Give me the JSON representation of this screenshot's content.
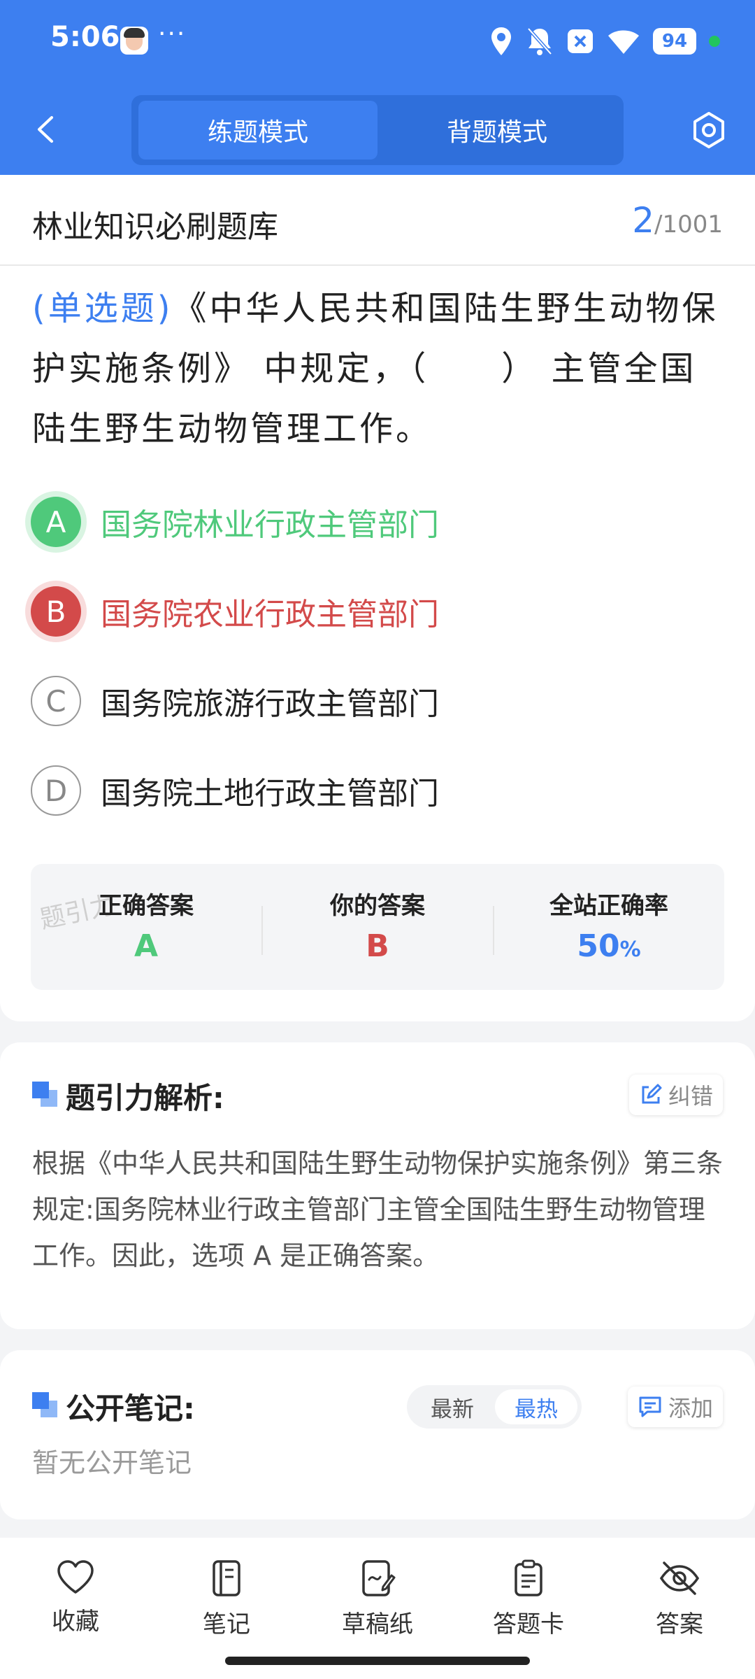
{
  "status_bar": {
    "time": "5:06",
    "dots": "···",
    "battery": "94"
  },
  "nav": {
    "tabs": [
      {
        "label": "练题模式",
        "active": true
      },
      {
        "label": "背题模式",
        "active": false
      }
    ]
  },
  "question_bank": {
    "title": "林业知识必刷题库",
    "current": "2",
    "total": "/1001"
  },
  "question": {
    "type": "(单选题)",
    "text": "《中华人民共和国陆生野生动物保护实施条例》 中规定，（　　） 主管全国陆生野生动物管理工作。",
    "options": [
      {
        "letter": "A",
        "text": "国务院林业行政主管部门",
        "state": "correct"
      },
      {
        "letter": "B",
        "text": "国务院农业行政主管部门",
        "state": "wrong"
      },
      {
        "letter": "C",
        "text": "国务院旅游行政主管部门",
        "state": "normal"
      },
      {
        "letter": "D",
        "text": "国务院土地行政主管部门",
        "state": "normal"
      }
    ]
  },
  "answer_summary": {
    "correct_label": "正确答案",
    "correct_value": "A",
    "yours_label": "你的答案",
    "yours_value": "B",
    "rate_label": "全站正确率",
    "rate_value": "50",
    "rate_unit": "%",
    "watermark": "题引力"
  },
  "analysis": {
    "title": "题引力解析:",
    "report_label": "纠错",
    "text": "根据《中华人民共和国陆生野生动物保护实施条例》第三条规定:国务院林业行政主管部门主管全国陆生野生动物管理工作。因此，选项 A 是正确答案。"
  },
  "notes": {
    "title": "公开笔记:",
    "sort_latest": "最新",
    "sort_hot": "最热",
    "add_label": "添加",
    "empty": "暂无公开笔记"
  },
  "bottom_nav": [
    {
      "label": "收藏",
      "icon": "heart-icon"
    },
    {
      "label": "笔记",
      "icon": "notebook-icon"
    },
    {
      "label": "草稿纸",
      "icon": "draft-icon"
    },
    {
      "label": "答题卡",
      "icon": "answer-card-icon"
    },
    {
      "label": "答案",
      "icon": "eye-off-icon"
    }
  ],
  "colors": {
    "primary": "#3d7ff0",
    "correct": "#4fc97b",
    "wrong": "#d34a4a"
  }
}
